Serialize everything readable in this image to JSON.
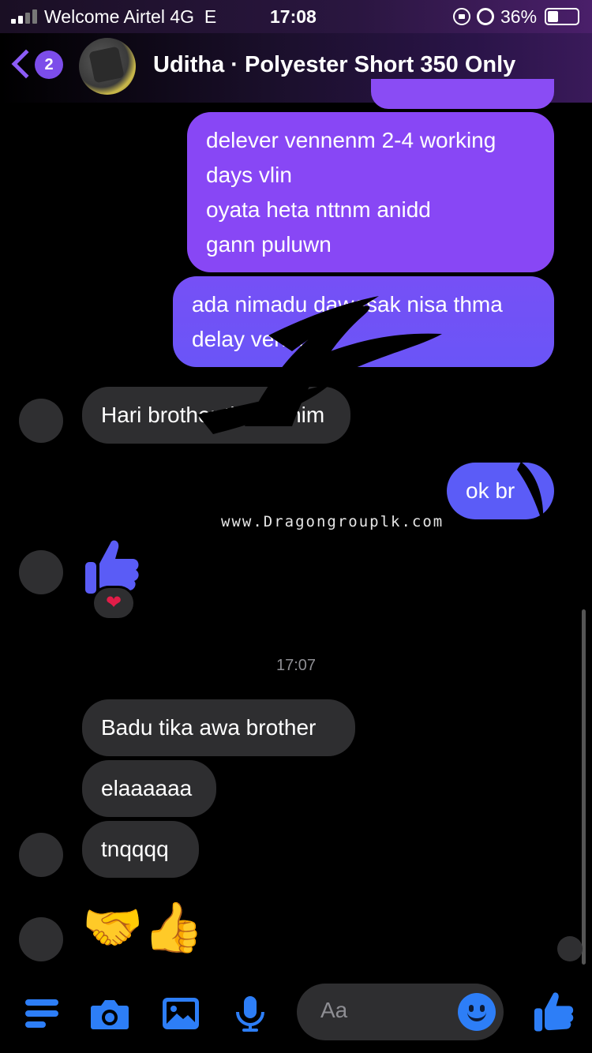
{
  "status_bar": {
    "carrier": "Welcome Airtel 4G",
    "network": "E",
    "time": "17:08",
    "battery_percent": "36%",
    "battery_level": 0.36
  },
  "header": {
    "back_badge": "2",
    "title": "Uditha · Polyester Short 350 Only",
    "accent_color": "#8b5cf6"
  },
  "messages": [
    {
      "direction": "outgoing",
      "text": "delever vennenm 2-4 working\ndays vlin\noyata heta nttnm anidd\ngann puluwn"
    },
    {
      "direction": "outgoing",
      "text": "ada nimadu dawasak nisa thma\ndelay venna"
    },
    {
      "direction": "incoming",
      "text": "Hari brother thankshim"
    },
    {
      "direction": "outgoing",
      "text": "ok br"
    },
    {
      "direction": "incoming",
      "type": "like-sticker",
      "reaction": "❤"
    },
    {
      "type": "timestamp",
      "text": "17:07"
    },
    {
      "direction": "incoming",
      "text": "Badu tika awa brother"
    },
    {
      "direction": "incoming",
      "text": "elaaaaaa"
    },
    {
      "direction": "incoming",
      "text": "tnqqqq"
    },
    {
      "direction": "incoming",
      "type": "emoji",
      "text": "🤝👍"
    }
  ],
  "watermark": "www.Dragongrouplk.com",
  "composer": {
    "placeholder": "Aa",
    "icons": [
      "menu-icon",
      "camera-icon",
      "image-icon",
      "microphone-icon",
      "emoji-icon",
      "like-icon"
    ],
    "icon_color": "#2d7ef7"
  },
  "colors": {
    "outgoing_top": "#8a4cf4",
    "outgoing_bottom": "#5b5cf7",
    "incoming": "#2e2e30"
  }
}
